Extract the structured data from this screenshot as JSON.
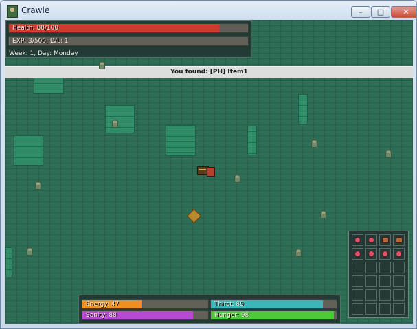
{
  "window": {
    "title": "Crawle",
    "min_label": "–",
    "max_label": "□",
    "close_label": "✕"
  },
  "hud_top": {
    "health_label": "Health: 88/100",
    "health": 88,
    "health_max": 100,
    "exp_label": "EXP: 3/500, LVL: 1",
    "exp": 3,
    "exp_max": 500,
    "week_label": "Week: 1, Day: Monday"
  },
  "notice": {
    "text": "You found: [PH] Item1"
  },
  "hud_bottom": {
    "energy_label": "Energy: 47",
    "energy": 47,
    "thirst_label": "Thirst: 89",
    "thirst": 89,
    "sanity_label": "Sanity: 88",
    "sanity": 88,
    "hunger_label": "Hunger: 98",
    "hunger": 98
  },
  "inventory": {
    "slots": [
      "gem-icon",
      "gem-icon",
      "potion-icon",
      "potion-icon",
      "gem-icon",
      "gem-icon",
      "gem-icon",
      "gem-icon",
      "",
      "",
      "",
      "",
      "",
      "",
      "",
      "",
      "",
      "",
      "",
      "",
      "",
      "",
      "",
      ""
    ]
  },
  "colors": {
    "health_fill": "#d23a2f",
    "exp_fill": "#7d7a75",
    "energy_fill": "#ef8f1f",
    "thirst_fill": "#3bb7b8",
    "sanity_fill": "#b64ad2",
    "hunger_fill": "#4ec93a",
    "bar_bg": "#625f56"
  }
}
